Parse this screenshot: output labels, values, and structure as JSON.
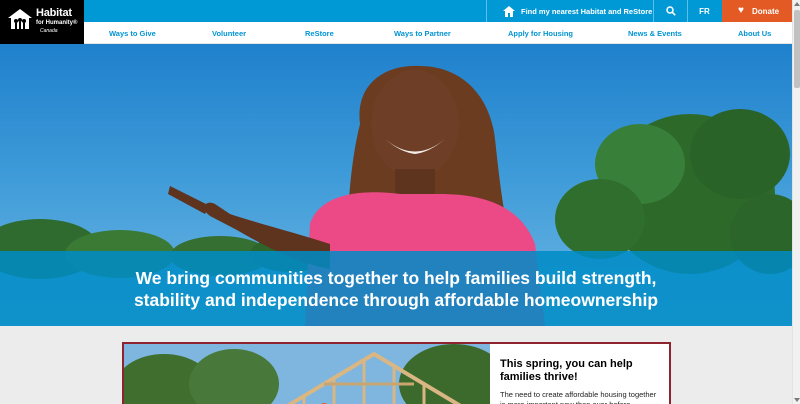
{
  "brand": {
    "line1": "Habitat",
    "line2": "for Humanity®",
    "line3": "Canada"
  },
  "topbar": {
    "find_label": "Find my nearest Habitat and ReStore",
    "lang_label": "FR",
    "donate_label": "Donate"
  },
  "nav": {
    "items": [
      "Ways to Give",
      "Volunteer",
      "ReStore",
      "Ways to Partner",
      "Apply for Housing",
      "News & Events",
      "About Us"
    ]
  },
  "hero": {
    "headline_line1": "We bring communities together to help families build strength,",
    "headline_line2": "stability and independence through affordable homeownership"
  },
  "feature": {
    "title": "This spring, you can help families thrive!",
    "body": "The need to create affordable housing together is more important now than ever before, especially"
  },
  "colors": {
    "brand_blue": "#0099d6",
    "donate_orange": "#e35a24",
    "card_border": "#8f2330"
  }
}
